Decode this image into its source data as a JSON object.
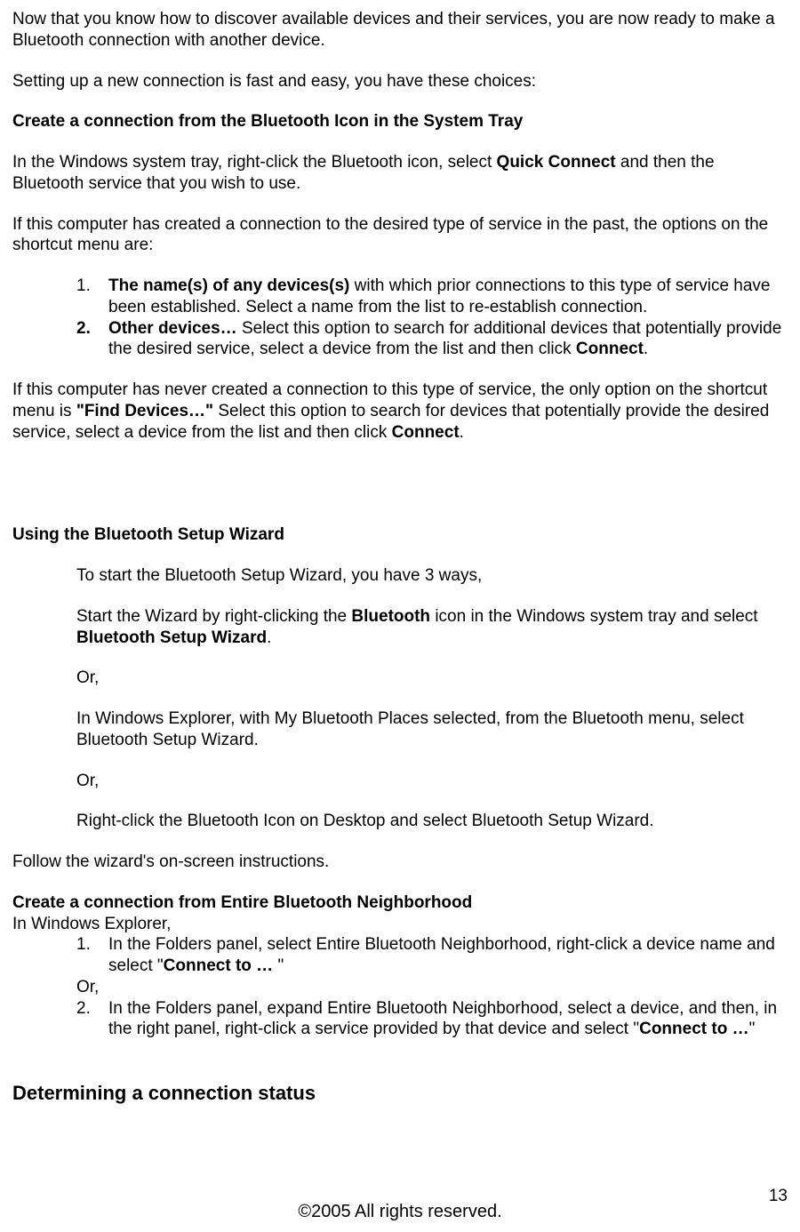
{
  "p1": "Now that you know how to discover available devices and their services, you are now ready to make a Bluetooth connection with another device.",
  "p2": "Setting up a new connection is fast and easy, you have these choices:",
  "h1": "Create a connection from the Bluetooth Icon in the System Tray",
  "p3a": "In the Windows system tray, right-click the Bluetooth icon, select ",
  "p3b": "Quick Connect",
  "p3c": " and then the Bluetooth service that you wish to use.",
  "p4": "If this computer has created a connection to the desired type of service in the past, the options on the shortcut menu are:",
  "l1_num": "1.",
  "l1a": "The name(s) of any devices(s)",
  "l1b": " with which prior connections to this type of service have been established. Select a name from the list to re-establish connection.",
  "l2_num": "2.",
  "l2a": "Other devices…",
  "l2b": " Select this option to search for additional devices that potentially provide the desired service, select a device from the list and then click ",
  "l2c": "Connect",
  "l2d": ".",
  "p5a": "If this computer has never created a connection to this type of service, the only option on the shortcut menu is ",
  "p5b": "\"Find Devices…\"",
  "p5c": " Select this option to search for devices that potentially provide the desired service, select a device from the list and then click ",
  "p5d": "Connect",
  "p5e": ".",
  "h2": "Using the Bluetooth Setup Wizard",
  "w1": "To start the Bluetooth Setup Wizard, you have 3 ways,",
  "w2a": "Start the Wizard by right-clicking the ",
  "w2b": "Bluetooth",
  "w2c": " icon in the Windows system tray and select ",
  "w2d": "Bluetooth Setup Wizard",
  "w2e": ".",
  "or": "Or,",
  "w3": "In Windows Explorer, with My Bluetooth Places selected, from the Bluetooth menu, select Bluetooth Setup Wizard.",
  "w4": "Right-click the Bluetooth Icon on Desktop and select Bluetooth Setup Wizard.",
  "p6": "Follow the wizard's on-screen instructions.",
  "h3": "Create a connection from Entire Bluetooth Neighborhood",
  "p7": "In Windows Explorer,",
  "n1_num": "1.",
  "n1a": "In the Folders panel, select Entire Bluetooth Neighborhood, right-click a device name and select \"",
  "n1b": "Connect to … ",
  "n1c": "\"",
  "n2_num": "2.",
  "n2a": "In the Folders panel, expand Entire Bluetooth Neighborhood, select a device, and then, in the right panel, right-click a service provided by that device and select \"",
  "n2b": "Connect to …",
  "n2c": "\"",
  "h4": "Determining a connection status",
  "footer": "©2005 All rights reserved.",
  "page_num": "13"
}
